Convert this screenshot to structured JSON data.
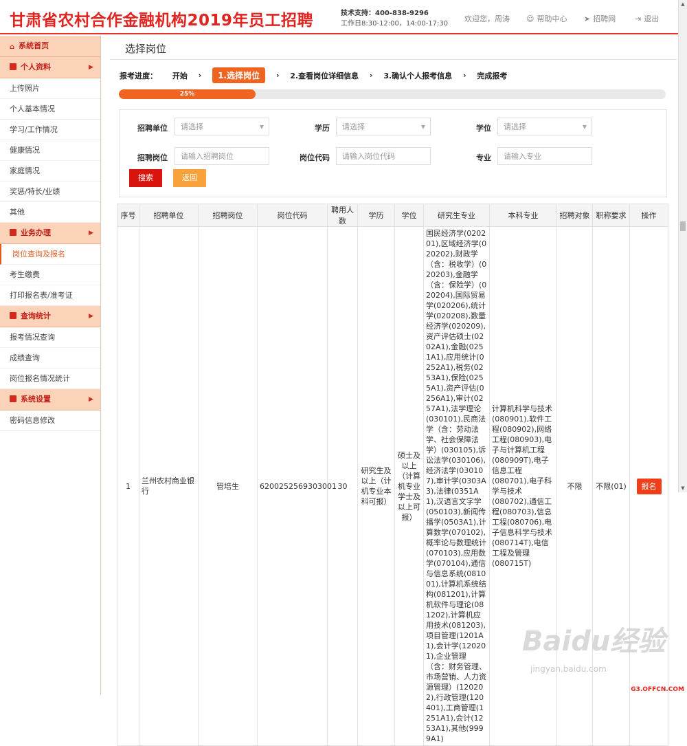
{
  "header": {
    "title": "甘肃省农村合作金融机构2019年员工招聘",
    "support_label": "技术支持：400-838-9296",
    "hours": "工作日8:30-12:00，14:00-17:30",
    "welcome": "欢迎您，周涛",
    "help": "帮助中心",
    "recruit_site": "招聘网",
    "logout": "退出"
  },
  "sidebar": {
    "home": "系统首页",
    "personal": "个人资料",
    "personal_items": [
      "上传照片",
      "个人基本情况",
      "学习/工作情况",
      "健康情况",
      "家庭情况",
      "奖惩/特长/业绩",
      "其他"
    ],
    "business": "业务办理",
    "business_items": [
      "岗位查询及报名",
      "考生缴费",
      "打印报名表/准考证"
    ],
    "query": "查询统计",
    "query_items": [
      "报考情况查询",
      "成绩查询",
      "岗位报名情况统计"
    ],
    "settings": "系统设置",
    "settings_items": [
      "密码信息修改"
    ]
  },
  "main": {
    "page_title": "选择岗位",
    "progress": {
      "label": "报考进度：",
      "steps": [
        "开始",
        "1.选择岗位",
        "2.查看岗位详细信息",
        "3.确认个人报考信息",
        "完成报考"
      ],
      "current_index": 1,
      "percent_text": "25%",
      "percent": 0.25
    },
    "filters": {
      "unit_label": "招聘单位",
      "unit_value": "请选择",
      "edu_label": "学历",
      "edu_value": "请选择",
      "degree_label": "学位",
      "degree_value": "请选择",
      "post_label": "招聘岗位",
      "post_placeholder": "请输入招聘岗位",
      "code_label": "岗位代码",
      "code_placeholder": "请输入岗位代码",
      "major_label": "专业",
      "major_placeholder": "请输入专业",
      "search_btn": "搜索",
      "back_btn": "返回"
    },
    "table": {
      "headers": [
        "序号",
        "招聘单位",
        "招聘岗位",
        "岗位代码",
        "聘用人数",
        "学历",
        "学位",
        "研究生专业",
        "本科专业",
        "招聘对象",
        "职称要求",
        "操作"
      ],
      "row": {
        "no": "1",
        "unit": "兰州农村商业银行",
        "post": "管培生",
        "code": "6200252569303001",
        "count": "30",
        "edu": "研究生及以上（计机专业本科可报）",
        "degree": "硕士及以上（计算机专业学士及以上可报）",
        "grad_major": "国民经济学(020201),区域经济学(020202),财政学（含：税收学）(020203),金融学（含：保险学）(020204),国际贸易学(020206),统计学(020208),数量经济学(020209),资产评估硕士(0202A1),金融(0251A1),应用统计(0252A1),税务(0253A1),保险(0255A1),资产评估(0256A1),审计(0257A1),法学理论(030101),民商法学（含：劳动法学、社会保障法学）(030105),诉讼法学(030106),经济法学(030107),审计学(0303A3),法律(0351A1),汉语言文字学(050103),新闻传播学(0503A1),计算数学(070102),概率论与数理统计(070103),应用数学(070104),通信与信息系统(081001),计算机系统结构(081201),计算机软件与理论(081202),计算机应用技术(081203),项目管理(1201A1),会计学(120201),企业管理（含：财务管理、市场营销、人力资源管理）(120202),行政管理(120401),工商管理(1251A1),会计(1253A1),其他(9999A1)",
        "ug_major": "计算机科学与技术(080901),软件工程(080902),网络工程(080903),电子与计算机工程(080909T),电子信息工程(080701),电子科学与技术(080702),通信工程(080703),信息工程(080706),电子信息科学与技术(080714T),电信工程及管理(080715T)",
        "target": "不限",
        "title_req": "不限(01)",
        "action": "报名"
      }
    }
  },
  "watermark": "Baidu经验",
  "watermark_sub": "jingyan.baidu.com",
  "corner_mark": "G3.OFFCN.COM"
}
